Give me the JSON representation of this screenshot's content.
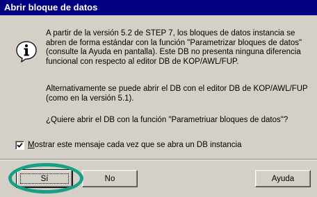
{
  "dialog": {
    "title": "Abrir bloque de datos",
    "icon": "information-icon",
    "paragraph1": "A partir de la versión 5.2 de STEP 7, los bloques de datos instancia se abren de forma estándar con la función \"Parametrizar bloques de datos\" (consulte la Ayuda en pantalla). Este DB no presenta ninguna diferencia funcional con respecto al editor DB de KOP/AWL/FUP.",
    "paragraph2": "Alternativamente se puede abrir el DB con el editor DB de KOP/AWL/FUP (como en la versión 5.1).",
    "question": "¿Quiere abrir el DB con la función \"Parametriuar bloques de datos\"?",
    "checkbox": {
      "label_prefix": "M",
      "label_rest": "ostrar este mensaje cada vez que se abra un DB instancia",
      "checked": true
    },
    "buttons": {
      "yes": "Sí",
      "no": "No",
      "help": "Ayuda"
    },
    "highlight_color": "#16a086"
  }
}
